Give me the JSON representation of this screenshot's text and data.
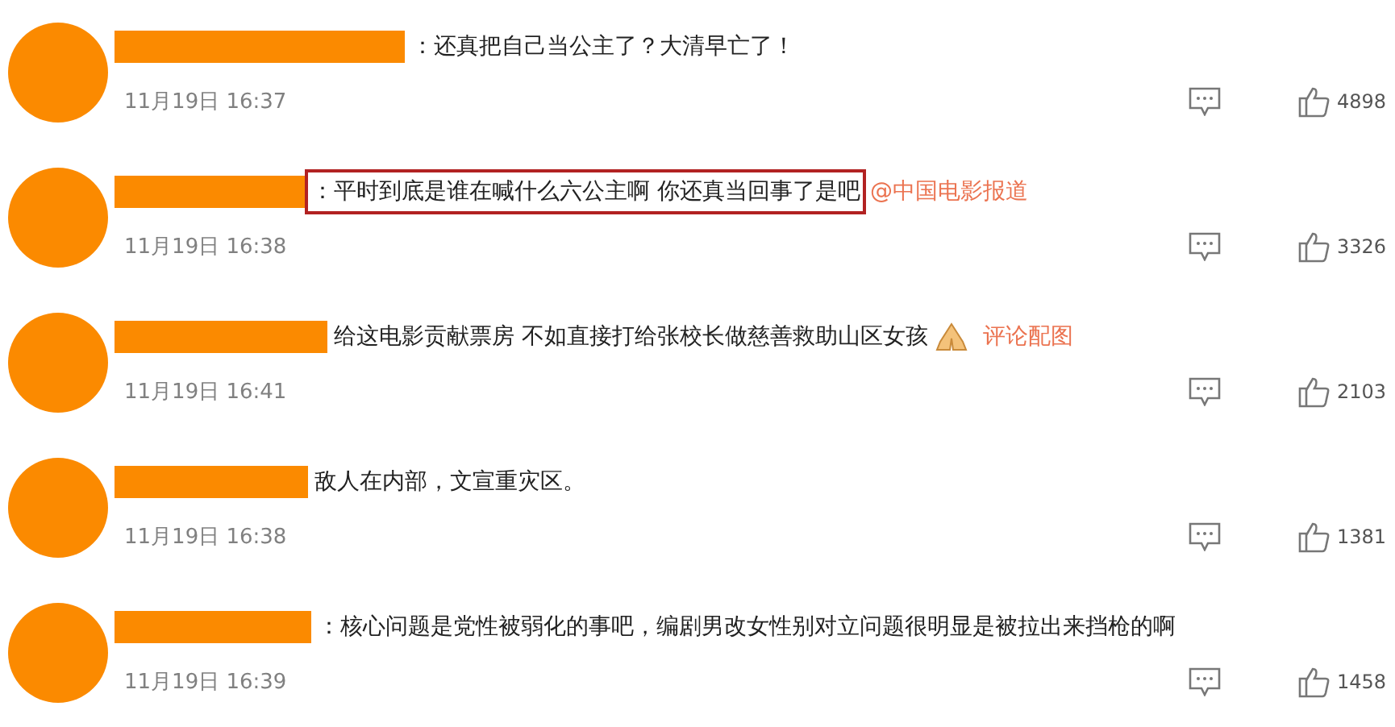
{
  "comments": [
    {
      "text": "：还真把自己当公主了？大清早亡了！",
      "highlighted": false,
      "date": "11月19日 16:37",
      "likes": "4898"
    },
    {
      "text": "：平时到底是谁在喊什么六公主啊 你还真当回事了是吧",
      "highlighted": true,
      "link": "@中国电影报道",
      "date": "11月19日 16:38",
      "likes": "3326"
    },
    {
      "text": "给这电影贡献票房 不如直接打给张校长做慈善救助山区女孩",
      "highlighted": false,
      "emoji": true,
      "picture_link": "评论配图",
      "date": "11月19日 16:41",
      "likes": "2103"
    },
    {
      "text": "敌人在内部，文宣重灾区。",
      "highlighted": false,
      "date": "11月19日 16:38",
      "likes": "1381"
    },
    {
      "text": "：核心问题是党性被弱化的事吧，编剧男改女性别对立问题很明显是被拉出来挡枪的啊",
      "highlighted": false,
      "date": "11月19日 16:39",
      "likes": "1458"
    }
  ]
}
